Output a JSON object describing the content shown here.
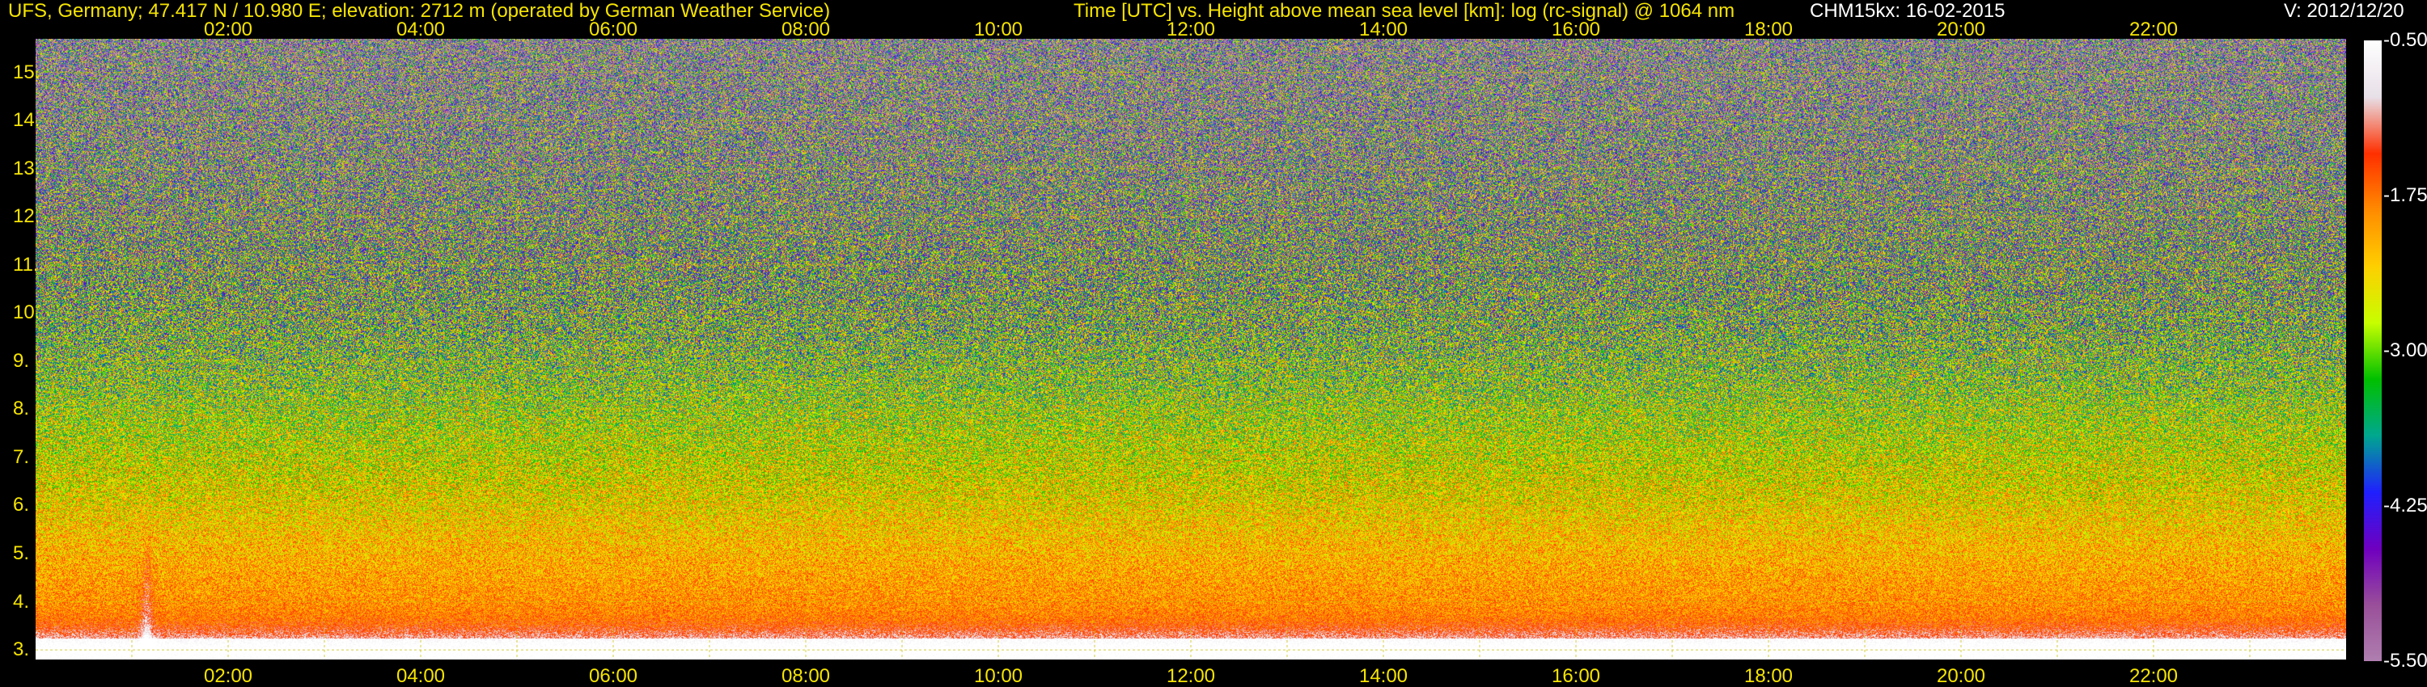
{
  "header": {
    "station": "UFS, Germany; 47.417 N / 10.980 E; elevation: 2712 m  (operated by German Weather Service)",
    "axes_title": "Time [UTC] vs. Height above mean sea level [km]: log (rc-signal) @ 1064 nm",
    "instrument": "CHM15kx: 16-02-2015",
    "version": "V: 2012/12/20"
  },
  "colors": {
    "text": "#f6e400",
    "grid": "#c8c000",
    "background": "#000000"
  },
  "chart_data": {
    "type": "heatmap",
    "title": "Time [UTC] vs. Height above mean sea level [km]: log (rc-signal) @ 1064 nm",
    "xlabel": "Time [UTC]",
    "ylabel": "Height above mean sea level [km]",
    "xlim": [
      "00:00",
      "24:00"
    ],
    "ylim": [
      2.8,
      15.7
    ],
    "x_ticks": [
      "02:00",
      "04:00",
      "06:00",
      "08:00",
      "10:00",
      "12:00",
      "14:00",
      "16:00",
      "18:00",
      "20:00",
      "22:00"
    ],
    "y_ticks": [
      "3.",
      "4.",
      "5.",
      "6.",
      "7.",
      "8.",
      "9.",
      "10.",
      "11.",
      "12.",
      "13.",
      "14.",
      "15."
    ],
    "colorbar": {
      "range": [
        -5.5,
        -0.5
      ],
      "ticks": [
        "-0.50",
        "-1.75",
        "-3.00",
        "-4.25",
        "-5.50"
      ],
      "colors": [
        "#ffffff",
        "#e8e0e8",
        "#ff3000",
        "#ff8c00",
        "#ffd000",
        "#c8ff00",
        "#00c000",
        "#00a890",
        "#2020ff",
        "#7000c0",
        "#9a509a",
        "#b080b0"
      ]
    },
    "grid": true,
    "notes": "Noisy background signal; strong near-surface layer below ~4 km; vertical spike near 01:00"
  }
}
